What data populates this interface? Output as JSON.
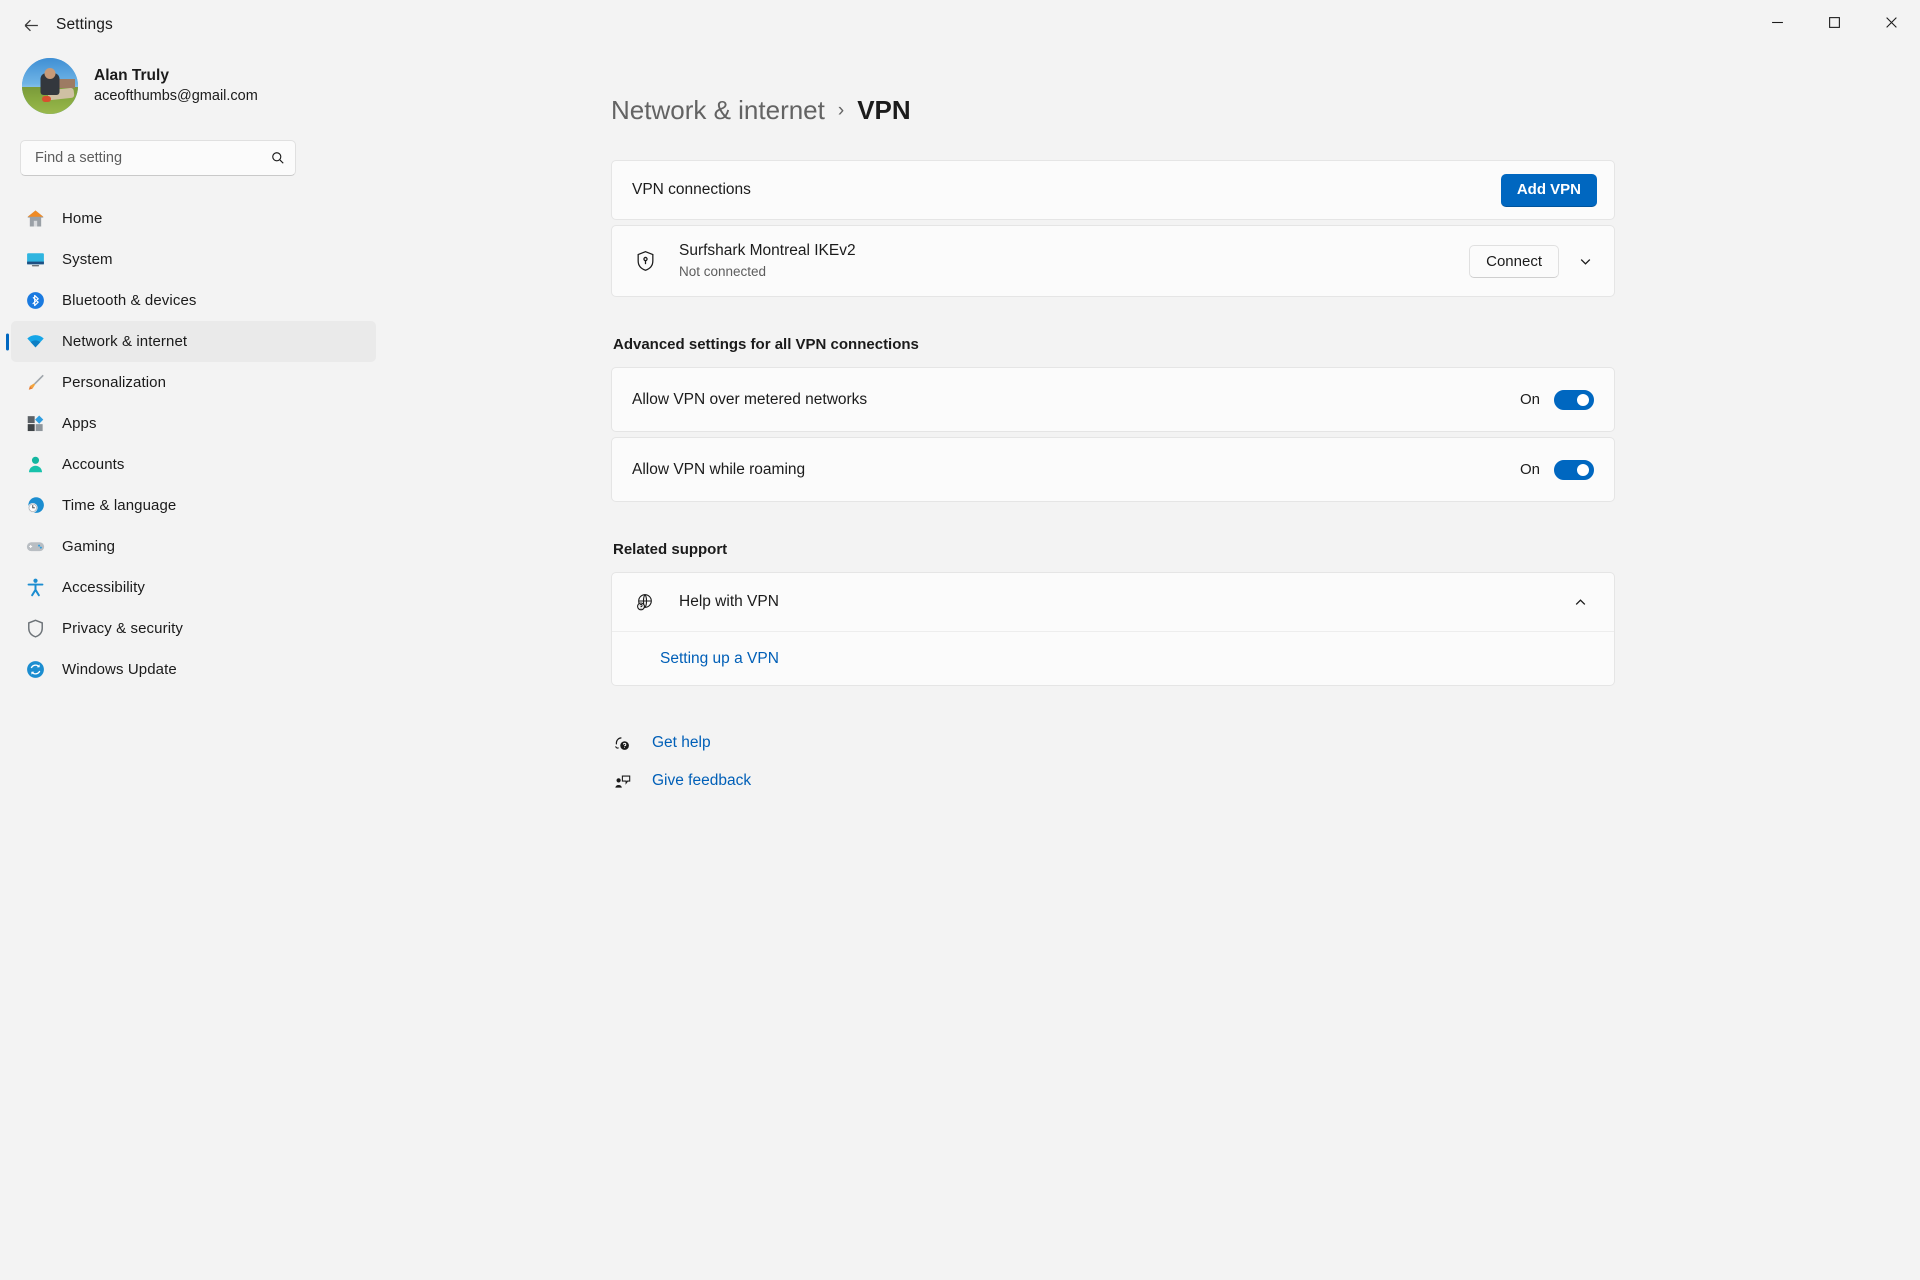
{
  "window": {
    "app_title": "Settings",
    "back_icon": "back-arrow-icon",
    "controls": {
      "minimize": "minimize-icon",
      "maximize": "maximize-icon",
      "close": "close-icon"
    }
  },
  "account": {
    "name": "Alan Truly",
    "email": "aceofthumbs@gmail.com",
    "avatar_icon": "user-avatar-photo"
  },
  "search": {
    "placeholder": "Find a setting",
    "value": "",
    "icon": "search-icon"
  },
  "sidebar": {
    "items": [
      {
        "label": "Home",
        "icon": "home-icon",
        "active": false
      },
      {
        "label": "System",
        "icon": "system-icon",
        "active": false
      },
      {
        "label": "Bluetooth & devices",
        "icon": "bluetooth-icon",
        "active": false
      },
      {
        "label": "Network & internet",
        "icon": "wifi-icon",
        "active": true
      },
      {
        "label": "Personalization",
        "icon": "paintbrush-icon",
        "active": false
      },
      {
        "label": "Apps",
        "icon": "apps-icon",
        "active": false
      },
      {
        "label": "Accounts",
        "icon": "accounts-icon",
        "active": false
      },
      {
        "label": "Time & language",
        "icon": "clock-globe-icon",
        "active": false
      },
      {
        "label": "Gaming",
        "icon": "gamepad-icon",
        "active": false
      },
      {
        "label": "Accessibility",
        "icon": "accessibility-icon",
        "active": false
      },
      {
        "label": "Privacy & security",
        "icon": "shield-icon",
        "active": false
      },
      {
        "label": "Windows Update",
        "icon": "windows-update-icon",
        "active": false
      }
    ]
  },
  "breadcrumb": {
    "parent": "Network & internet",
    "separator": "›",
    "current": "VPN"
  },
  "vpn_connections": {
    "title": "VPN connections",
    "add_button": "Add VPN",
    "profile": {
      "name": "Surfshark Montreal IKEv2",
      "status": "Not connected",
      "icon": "vpn-shield-icon",
      "connect_button": "Connect",
      "expand_icon": "chevron-down-icon"
    }
  },
  "advanced": {
    "heading": "Advanced settings for all VPN connections",
    "settings": [
      {
        "label": "Allow VPN over metered networks",
        "state": "On",
        "on": true
      },
      {
        "label": "Allow VPN while roaming",
        "state": "On",
        "on": true
      }
    ]
  },
  "related_support": {
    "heading": "Related support",
    "help": {
      "label": "Help with VPN",
      "icon": "globe-help-icon",
      "collapse_icon": "chevron-up-icon",
      "expanded": true
    },
    "links": [
      {
        "label": "Setting up a VPN"
      }
    ]
  },
  "footer_links": [
    {
      "label": "Get help",
      "icon": "get-help-icon"
    },
    {
      "label": "Give feedback",
      "icon": "give-feedback-icon"
    }
  ],
  "colors": {
    "accent": "#0067c0",
    "link": "#005fb7",
    "page_bg": "#f3f3f3",
    "card_bg": "#fbfbfb"
  }
}
